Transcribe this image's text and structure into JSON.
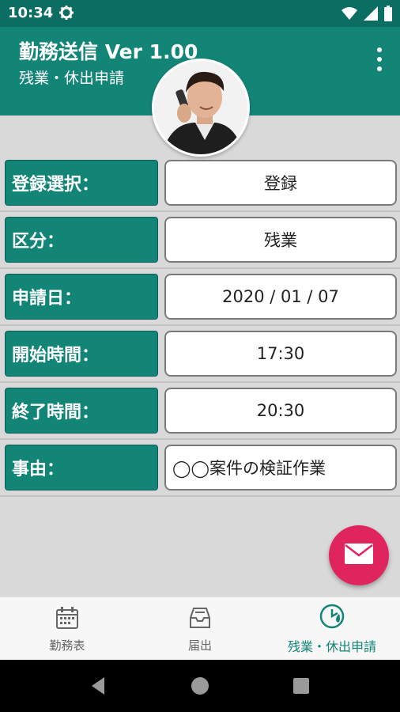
{
  "status_bar": {
    "time": "10:34",
    "icons": [
      "gear-icon",
      "wifi-icon",
      "signal-icon",
      "battery-icon"
    ]
  },
  "app_bar": {
    "title": "勤務送信 Ver 1.00",
    "subtitle": "残業・休出申請",
    "menu_icon": "more-vert-icon"
  },
  "form": {
    "rows": [
      {
        "label": "登録選択：",
        "value": "登録"
      },
      {
        "label": "区分：",
        "value": "残業"
      },
      {
        "label": "申請日：",
        "value": "2020 / 01 / 07"
      },
      {
        "label": "開始時間：",
        "value": "17:30"
      },
      {
        "label": "終了時間：",
        "value": "20:30"
      },
      {
        "label": "事由：",
        "value": "◯◯案件の検証作業"
      }
    ]
  },
  "fab": {
    "icon": "mail-icon"
  },
  "bottom_nav": {
    "items": [
      {
        "label": "勤務表",
        "icon": "calendar-icon",
        "active": false
      },
      {
        "label": "届出",
        "icon": "inbox-icon",
        "active": false
      },
      {
        "label": "残業・休出申請",
        "icon": "clock-icon",
        "active": true
      }
    ]
  },
  "colors": {
    "primary": "#138577",
    "primary_dark": "#0c6e62",
    "accent": "#e0245e",
    "background": "#d9d9d9"
  }
}
